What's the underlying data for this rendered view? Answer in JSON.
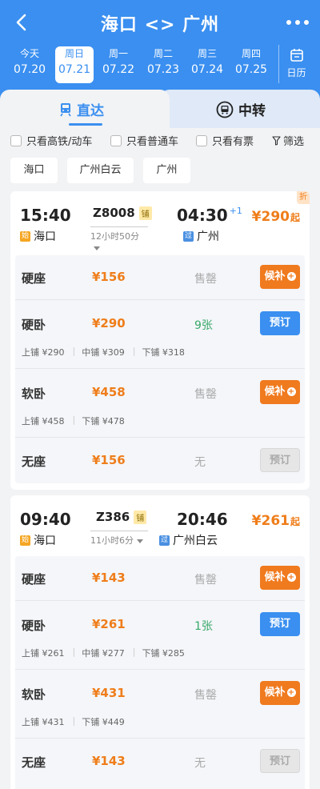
{
  "header": {
    "title": "海口 <> 广州"
  },
  "dates": [
    {
      "weekday": "今天",
      "date": "07.20",
      "active": false
    },
    {
      "weekday": "周日",
      "date": "07.21",
      "active": true
    },
    {
      "weekday": "周一",
      "date": "07.22",
      "active": false
    },
    {
      "weekday": "周二",
      "date": "07.23",
      "active": false
    },
    {
      "weekday": "周三",
      "date": "07.24",
      "active": false
    },
    {
      "weekday": "周四",
      "date": "07.25",
      "active": false
    }
  ],
  "calendar_label": "日历",
  "tabs": {
    "direct": "直达",
    "transfer": "中转"
  },
  "filters": {
    "high_speed": "只看高铁/动车",
    "normal": "只看普通车",
    "available": "只看有票",
    "filter": "筛选"
  },
  "stations": [
    "海口",
    "广州白云",
    "广州"
  ],
  "trains": [
    {
      "dep_time": "15:40",
      "arr_time": "04:30",
      "day_plus": "+1",
      "number": "Z8008",
      "bed_tag": "铺",
      "duration": "12小时50分",
      "from": "海口",
      "from_tag": "始",
      "to": "广州",
      "to_tag": "过",
      "price": "¥290",
      "price_suffix": "起",
      "discount": "折",
      "seats": {
        "hard_seat": {
          "name": "硬座",
          "price": "¥156",
          "status": "售罄",
          "action": "候补"
        },
        "hard_sleeper": {
          "name": "硬卧",
          "price": "¥290",
          "status": "9张",
          "action": "预订",
          "berths": {
            "upper": "上铺 ¥290",
            "middle": "中铺 ¥309",
            "lower": "下铺 ¥318"
          }
        },
        "soft_sleeper": {
          "name": "软卧",
          "price": "¥458",
          "status": "售罄",
          "action": "候补",
          "berths": {
            "upper": "上铺 ¥458",
            "lower": "下铺 ¥478"
          }
        },
        "no_seat": {
          "name": "无座",
          "price": "¥156",
          "status": "无",
          "action": "预订"
        }
      }
    },
    {
      "dep_time": "09:40",
      "arr_time": "20:46",
      "number": "Z386",
      "bed_tag": "铺",
      "duration": "11小时6分",
      "from": "海口",
      "from_tag": "始",
      "to": "广州白云",
      "to_tag": "过",
      "price": "¥261",
      "price_suffix": "起",
      "seats": {
        "hard_seat": {
          "name": "硬座",
          "price": "¥143",
          "status": "售罄",
          "action": "候补"
        },
        "hard_sleeper": {
          "name": "硬卧",
          "price": "¥261",
          "status": "1张",
          "action": "预订",
          "berths": {
            "upper": "上铺 ¥261",
            "middle": "中铺 ¥277",
            "lower": "下铺 ¥285"
          }
        },
        "soft_sleeper": {
          "name": "软卧",
          "price": "¥431",
          "status": "售罄",
          "action": "候补",
          "berths": {
            "upper": "上铺 ¥431",
            "lower": "下铺 ¥449"
          }
        },
        "no_seat": {
          "name": "无座",
          "price": "¥143",
          "status": "无",
          "action": "预订"
        }
      }
    }
  ],
  "colors": {
    "primary": "#3a8ff0",
    "accent_orange": "#f07a1e",
    "price": "#ef7d1a",
    "available_green": "#3aa86a"
  }
}
